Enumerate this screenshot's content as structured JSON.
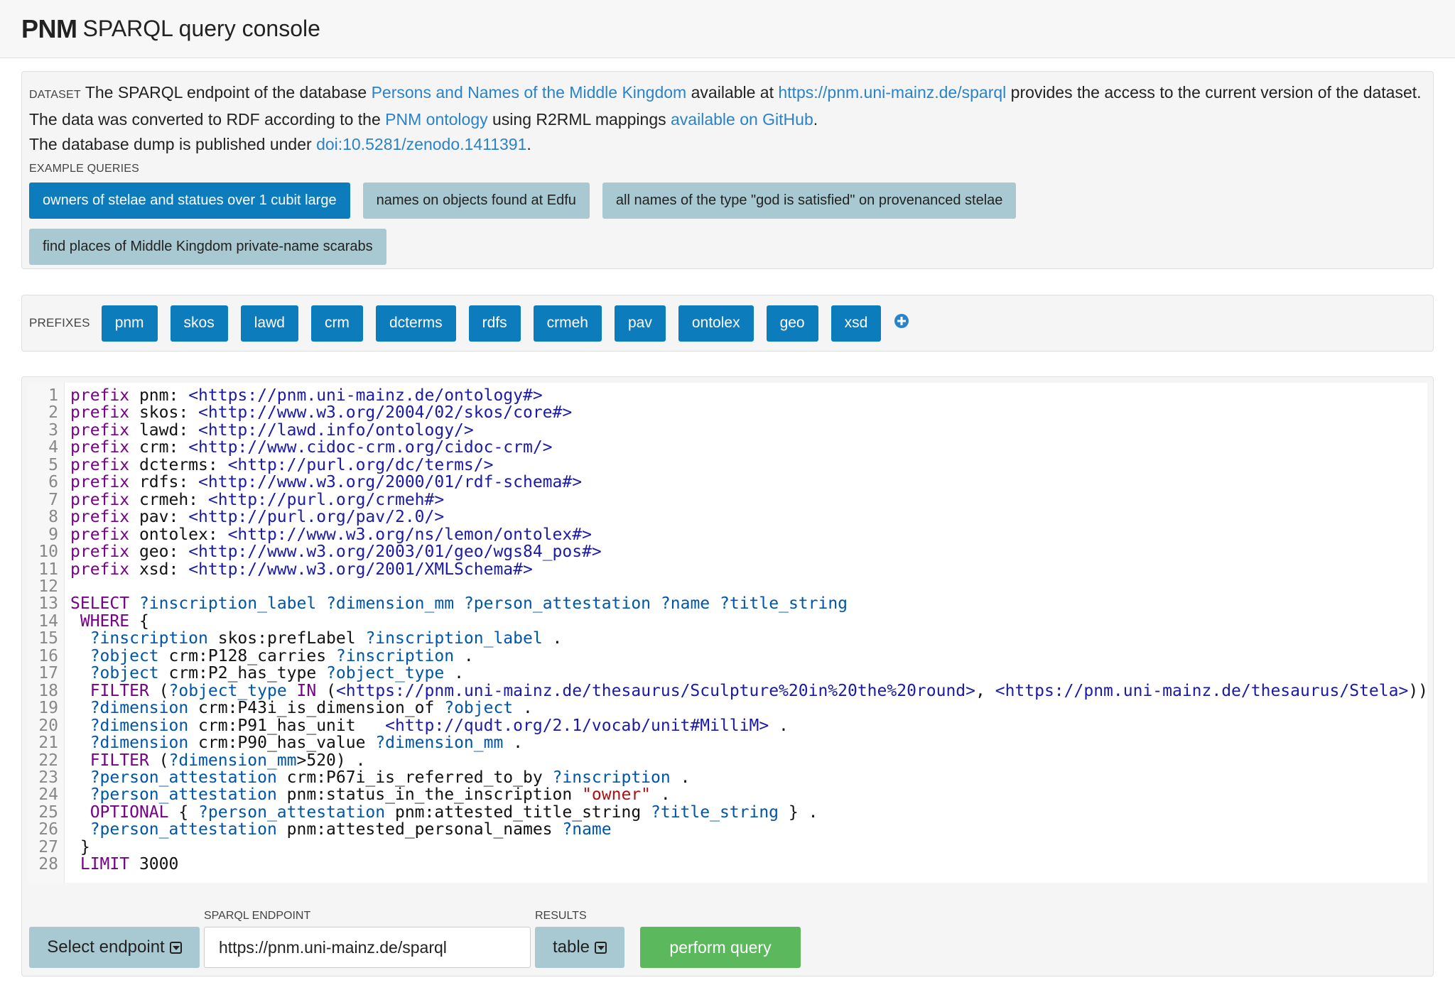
{
  "header": {
    "brand": "PNM",
    "subtitle": "SPARQL query console"
  },
  "dataset": {
    "label": "DATASET",
    "text1": "The SPARQL endpoint of the database ",
    "link_db": "Persons and Names of the Middle Kingdom",
    "text2": " available at ",
    "link_endpoint": "https://pnm.uni-mainz.de/sparql",
    "text3": " provides the access to the current version of the dataset. The data was converted to RDF according to the ",
    "link_ontology": "PNM ontology",
    "text4": " using R2RML mappings ",
    "link_github": "available on GitHub",
    "text5": ".",
    "text6": "The database dump is published under ",
    "link_doi": "doi:10.5281/zenodo.1411391",
    "text7": "."
  },
  "examples": {
    "label": "EXAMPLE QUERIES",
    "items": [
      "owners of stelae and statues over 1 cubit large",
      "names on objects found at Edfu",
      "all names of the type \"god is satisfied\" on provenanced stelae",
      "find places of Middle Kingdom private-name scarabs"
    ]
  },
  "prefixes": {
    "label": "PREFIXES",
    "items": [
      "pnm",
      "skos",
      "lawd",
      "crm",
      "dcterms",
      "rdfs",
      "crmeh",
      "pav",
      "ontolex",
      "geo",
      "xsd"
    ]
  },
  "editor": {
    "lines": [
      "prefix pnm: <https://pnm.uni-mainz.de/ontology#>",
      "prefix skos: <http://www.w3.org/2004/02/skos/core#>",
      "prefix lawd: <http://lawd.info/ontology/>",
      "prefix crm: <http://www.cidoc-crm.org/cidoc-crm/>",
      "prefix dcterms: <http://purl.org/dc/terms/>",
      "prefix rdfs: <http://www.w3.org/2000/01/rdf-schema#>",
      "prefix crmeh: <http://purl.org/crmeh#>",
      "prefix pav: <http://purl.org/pav/2.0/>",
      "prefix ontolex: <http://www.w3.org/ns/lemon/ontolex#>",
      "prefix geo: <http://www.w3.org/2003/01/geo/wgs84_pos#>",
      "prefix xsd: <http://www.w3.org/2001/XMLSchema#>",
      "",
      "SELECT ?inscription_label ?dimension_mm ?person_attestation ?name ?title_string",
      " WHERE {",
      "  ?inscription skos:prefLabel ?inscription_label .",
      "  ?object crm:P128_carries ?inscription .",
      "  ?object crm:P2_has_type ?object_type .",
      "  FILTER (?object_type IN (<https://pnm.uni-mainz.de/thesaurus/Sculpture%20in%20the%20round>, <https://pnm.uni-mainz.de/thesaurus/Stela>))",
      "  ?dimension crm:P43i_is_dimension_of ?object .",
      "  ?dimension crm:P91_has_unit   <http://qudt.org/2.1/vocab/unit#MilliM> .",
      "  ?dimension crm:P90_has_value ?dimension_mm .",
      "  FILTER (?dimension_mm>520) .",
      "  ?person_attestation crm:P67i_is_referred_to_by ?inscription .",
      "  ?person_attestation pnm:status_in_the_inscription \"owner\" .",
      "  OPTIONAL { ?person_attestation pnm:attested_title_string ?title_string } .",
      "  ?person_attestation pnm:attested_personal_names ?name",
      " }",
      " LIMIT 3000"
    ]
  },
  "controls": {
    "select_endpoint": "Select endpoint",
    "endpoint_label": "SPARQL ENDPOINT",
    "endpoint_value": "https://pnm.uni-mainz.de/sparql",
    "results_label": "RESULTS",
    "results_value": "table",
    "run_label": "perform query"
  },
  "colors": {
    "primary": "#0c7cbd",
    "muted": "#a9c9d2",
    "success": "#5cb85c",
    "link": "#2a82c9"
  }
}
